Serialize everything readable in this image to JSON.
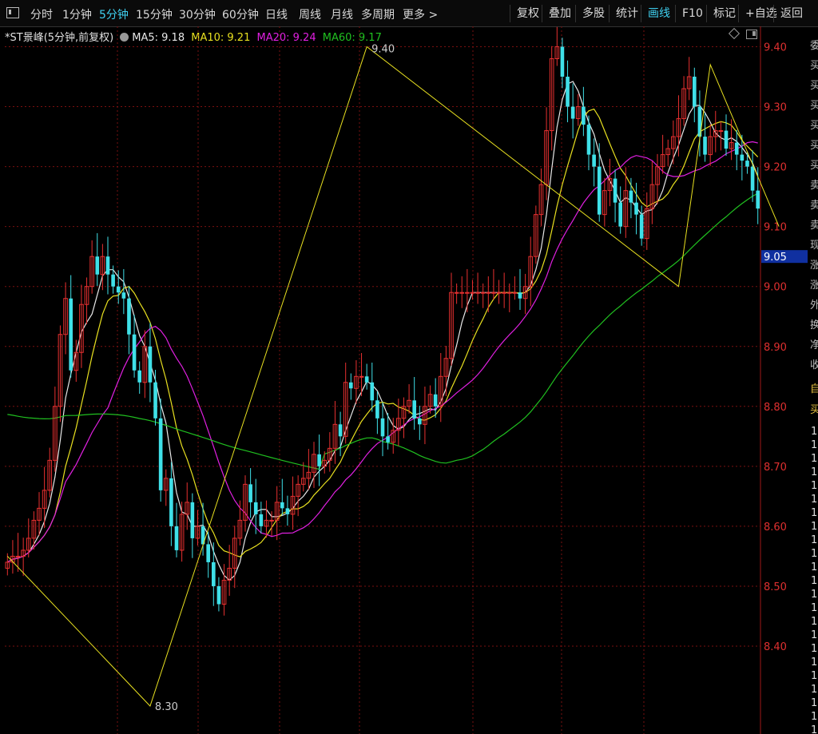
{
  "toolbar": {
    "left_items": [
      "分时",
      "1分钟",
      "5分钟",
      "15分钟",
      "30分钟",
      "60分钟",
      "日线",
      "周线",
      "月线",
      "多周期",
      "更多 >"
    ],
    "active_left": 2,
    "right_items": [
      "复权",
      "叠加",
      "多股",
      "统计",
      "画线",
      "F10",
      "标记",
      "+自选",
      "返回"
    ],
    "active_right": 4
  },
  "legend": {
    "title": "*ST景峰(5分钟,前复权)",
    "ma5": "MA5: 9.18",
    "ma10": "MA10: 9.21",
    "ma20": "MA20: 9.24",
    "ma60": "MA60: 9.17"
  },
  "colors": {
    "up": "#e83030",
    "down": "#3fe0e8",
    "ma5": "#e8e8e8",
    "ma10": "#e8e020",
    "ma20": "#e020e0",
    "ma60": "#20c020",
    "axis_text": "#e03030",
    "grid": "#7a1010",
    "zigzag": "#e8e020"
  },
  "icons": [
    "panel-toggle-icon",
    "settings-circle-icon",
    "diamond-icon",
    "window-icon"
  ],
  "right_strip": {
    "chars": [
      "委",
      "买",
      "买",
      "买",
      "买",
      "买",
      "买",
      "卖",
      "卖",
      "卖",
      "现",
      "涨",
      "涨",
      "外",
      "换",
      "净",
      "收"
    ],
    "badges": [
      "自",
      "买"
    ],
    "digits": [
      "1",
      "1",
      "1",
      "1",
      "1",
      "1",
      "1",
      "1",
      "1",
      "1",
      "1",
      "1",
      "1",
      "1",
      "1",
      "1",
      "1",
      "1",
      "1",
      "1",
      "1",
      "1",
      "1"
    ]
  },
  "chart_data": {
    "type": "candlestick",
    "title": "*ST景峰(5分钟,前复权)",
    "ylim": [
      8.3,
      9.42
    ],
    "y_ticks": [
      "9.40",
      "9.30",
      "9.20",
      "9.10",
      "9.00",
      "8.90",
      "8.80",
      "8.70",
      "8.60",
      "8.50",
      "8.40"
    ],
    "y_tick_values": [
      9.4,
      9.3,
      9.2,
      9.1,
      9.0,
      8.9,
      8.8,
      8.7,
      8.6,
      8.5,
      8.4
    ],
    "current_price": "9.05",
    "current_price_value": 9.05,
    "annotations": [
      {
        "text": "9.40",
        "index": 68,
        "price": 9.4
      },
      {
        "text": "8.30",
        "index": 27,
        "price": 8.3
      }
    ],
    "close": [
      8.54,
      8.55,
      8.55,
      8.56,
      8.58,
      8.61,
      8.63,
      8.66,
      8.71,
      8.8,
      8.92,
      8.98,
      8.86,
      8.89,
      8.97,
      9.0,
      9.05,
      9.02,
      9.05,
      9.02,
      9.0,
      8.99,
      8.98,
      8.92,
      8.86,
      8.84,
      8.9,
      8.84,
      8.78,
      8.66,
      8.68,
      8.6,
      8.56,
      8.62,
      8.64,
      8.58,
      8.6,
      8.57,
      8.54,
      8.5,
      8.47,
      8.51,
      8.53,
      8.58,
      8.61,
      8.67,
      8.64,
      8.62,
      8.6,
      8.61,
      8.61,
      8.64,
      8.63,
      8.62,
      8.65,
      8.67,
      8.68,
      8.69,
      8.72,
      8.7,
      8.71,
      8.73,
      8.77,
      8.75,
      8.84,
      8.83,
      8.85,
      8.85,
      8.84,
      8.81,
      8.78,
      8.75,
      8.74,
      8.76,
      8.78,
      8.8,
      8.81,
      8.78,
      8.77,
      8.8,
      8.82,
      8.8,
      8.85,
      8.88,
      8.99,
      8.99,
      8.99,
      8.99,
      8.99,
      8.99,
      8.99,
      8.99,
      8.99,
      8.99,
      8.99,
      8.99,
      8.99,
      8.98,
      9.0,
      9.05,
      9.12,
      9.17,
      9.26,
      9.38,
      9.4,
      9.35,
      9.3,
      9.28,
      9.3,
      9.27,
      9.22,
      9.2,
      9.12,
      9.16,
      9.18,
      9.14,
      9.1,
      9.16,
      9.14,
      9.12,
      9.08,
      9.13,
      9.17,
      9.2,
      9.22,
      9.23,
      9.25,
      9.28,
      9.33,
      9.35,
      9.3,
      9.25,
      9.22,
      9.25,
      9.26,
      9.26,
      9.23,
      9.24,
      9.22,
      9.21,
      9.2,
      9.16,
      9.13
    ],
    "series": [
      {
        "name": "MA5",
        "value_label": "9.18"
      },
      {
        "name": "MA10",
        "value_label": "9.21"
      },
      {
        "name": "MA20",
        "value_label": "9.24"
      },
      {
        "name": "MA60",
        "value_label": "9.17"
      }
    ]
  }
}
